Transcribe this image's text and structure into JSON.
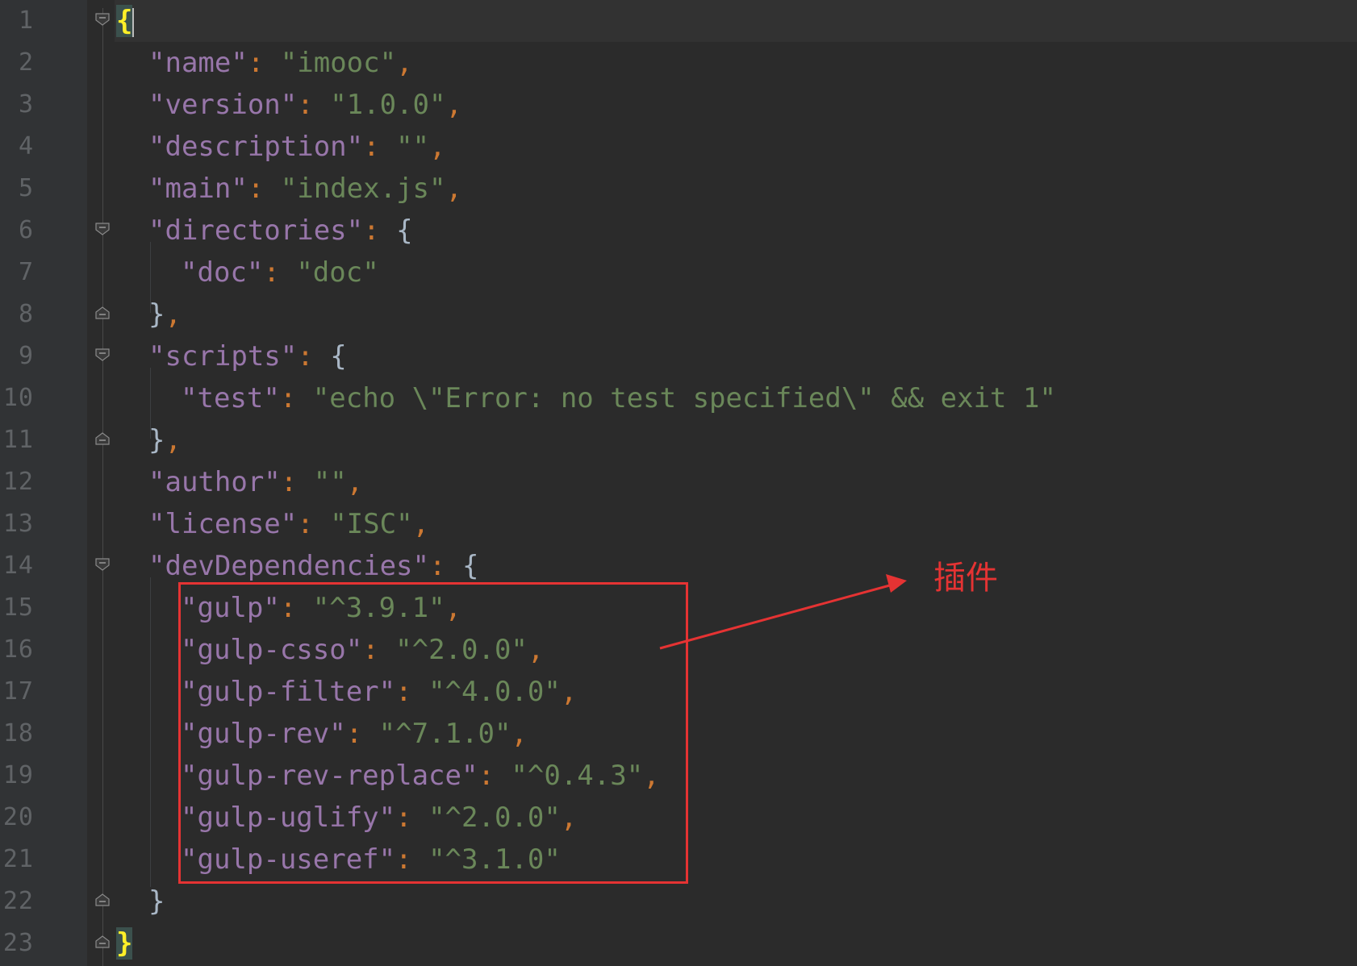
{
  "editor": {
    "lines": [
      {
        "n": "1"
      },
      {
        "n": "2",
        "key": "\"name\"",
        "val": "\"imooc\""
      },
      {
        "n": "3",
        "key": "\"version\"",
        "val": "\"1.0.0\""
      },
      {
        "n": "4",
        "key": "\"description\"",
        "val": "\"\""
      },
      {
        "n": "5",
        "key": "\"main\"",
        "val": "\"index.js\""
      },
      {
        "n": "6",
        "key": "\"directories\""
      },
      {
        "n": "7",
        "key": "\"doc\"",
        "val": "\"doc\""
      },
      {
        "n": "8"
      },
      {
        "n": "9",
        "key": "\"scripts\""
      },
      {
        "n": "10",
        "key": "\"test\"",
        "val": "\"echo \\\"Error: no test specified\\\" && exit 1\""
      },
      {
        "n": "11"
      },
      {
        "n": "12",
        "key": "\"author\"",
        "val": "\"\""
      },
      {
        "n": "13",
        "key": "\"license\"",
        "val": "\"ISC\""
      },
      {
        "n": "14",
        "key": "\"devDependencies\""
      },
      {
        "n": "15",
        "key": "\"gulp\"",
        "val": "\"^3.9.1\""
      },
      {
        "n": "16",
        "key": "\"gulp-csso\"",
        "val": "\"^2.0.0\""
      },
      {
        "n": "17",
        "key": "\"gulp-filter\"",
        "val": "\"^4.0.0\""
      },
      {
        "n": "18",
        "key": "\"gulp-rev\"",
        "val": "\"^7.1.0\""
      },
      {
        "n": "19",
        "key": "\"gulp-rev-replace\"",
        "val": "\"^0.4.3\""
      },
      {
        "n": "20",
        "key": "\"gulp-uglify\"",
        "val": "\"^2.0.0\""
      },
      {
        "n": "21",
        "key": "\"gulp-useref\"",
        "val": "\"^3.1.0\""
      },
      {
        "n": "22"
      },
      {
        "n": "23"
      }
    ]
  },
  "annotation": {
    "label": "插件",
    "color": "#e53333"
  },
  "colors": {
    "background": "#2b2b2b",
    "key": "#9876aa",
    "string": "#6a8759",
    "punctuation": "#cc7832",
    "brace": "#a9b7c6",
    "matched_brace": "#ffef28"
  }
}
